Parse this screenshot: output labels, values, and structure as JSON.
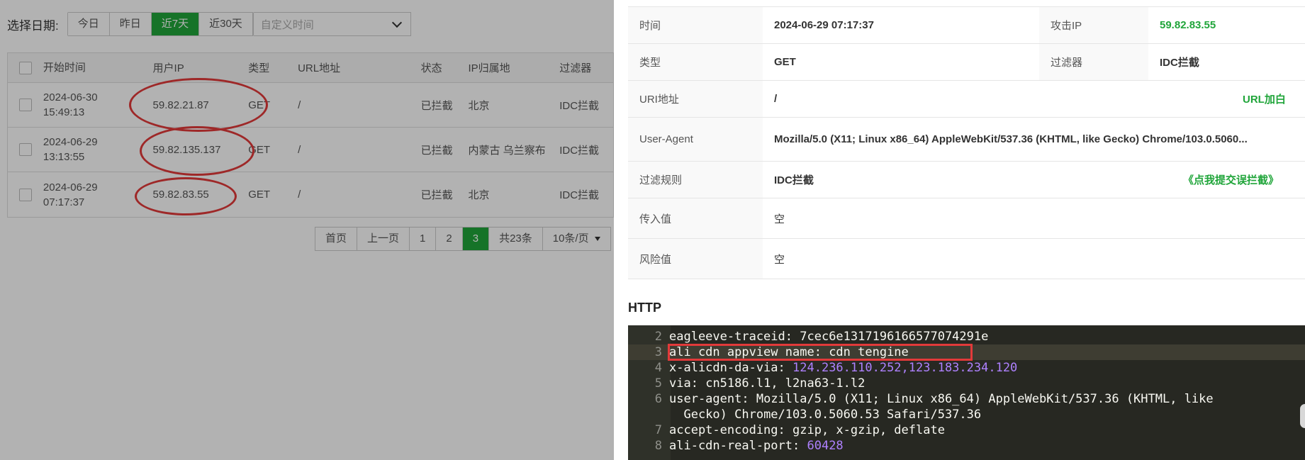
{
  "filter": {
    "label": "选择日期:",
    "options": [
      "今日",
      "昨日",
      "近7天",
      "近30天"
    ],
    "active_index": 2,
    "custom_placeholder": "自定义时间"
  },
  "table": {
    "headers": [
      "开始时间",
      "用户IP",
      "类型",
      "URL地址",
      "状态",
      "IP归属地",
      "过滤器"
    ],
    "rows": [
      {
        "date": "2024-06-30",
        "time": "15:49:13",
        "ip": "59.82.21.87",
        "type": "GET",
        "url": "/",
        "status": "已拦截",
        "region": "北京",
        "filter": "IDC拦截"
      },
      {
        "date": "2024-06-29",
        "time": "13:13:55",
        "ip": "59.82.135.137",
        "type": "GET",
        "url": "/",
        "status": "已拦截",
        "region": "内蒙古 乌兰察布",
        "filter": "IDC拦截"
      },
      {
        "date": "2024-06-29",
        "time": "07:17:37",
        "ip": "59.82.83.55",
        "type": "GET",
        "url": "/",
        "status": "已拦截",
        "region": "北京",
        "filter": "IDC拦截"
      }
    ]
  },
  "pagination": {
    "first": "首页",
    "prev": "上一页",
    "pages": [
      "1",
      "2",
      "3"
    ],
    "current": "3",
    "total": "共23条",
    "per_page": "10条/页"
  },
  "detail": {
    "time_label": "时间",
    "time_value": "2024-06-29 07:17:37",
    "attack_ip_label": "攻击IP",
    "attack_ip_value": "59.82.83.55",
    "type_label": "类型",
    "type_value": "GET",
    "filter_label": "过滤器",
    "filter_value": "IDC拦截",
    "uri_label": "URI地址",
    "uri_value": "/",
    "url_whitelist": "URL加白",
    "ua_label": "User-Agent",
    "ua_value": "Mozilla/5.0 (X11; Linux x86_64) AppleWebKit/537.36 (KHTML, like Gecko) Chrome/103.0.5060...",
    "rule_label": "过滤规则",
    "rule_value": "IDC拦截",
    "report_link": "《点我提交误拦截》",
    "input_label": "传入值",
    "input_value": "空",
    "risk_label": "风险值",
    "risk_value": "空"
  },
  "http": {
    "title": "HTTP",
    "lines": [
      {
        "n": "2",
        "key": "eagleeve-traceid",
        "val": "7cec6e1317196166577074291e"
      },
      {
        "n": "3",
        "key": "ali cdn appview name",
        "val": "cdn tengine"
      },
      {
        "n": "4",
        "key": "x-alicdn-da-via",
        "val": "124.236.110.252,123.183.234.120"
      },
      {
        "n": "5",
        "key": "via",
        "val": "cn5186.l1, l2na63-1.l2"
      },
      {
        "n": "6",
        "key": "user-agent",
        "val": "Mozilla/5.0 (X11; Linux x86_64) AppleWebKit/537.36 (KHTML, like"
      },
      {
        "n": "",
        "key": "",
        "val": "Gecko) Chrome/103.0.5060.53 Safari/537.36"
      },
      {
        "n": "7",
        "key": "accept-encoding",
        "val": "gzip, x-gzip, deflate"
      },
      {
        "n": "8",
        "key": "ali-cdn-real-port",
        "val": "60428"
      }
    ]
  }
}
